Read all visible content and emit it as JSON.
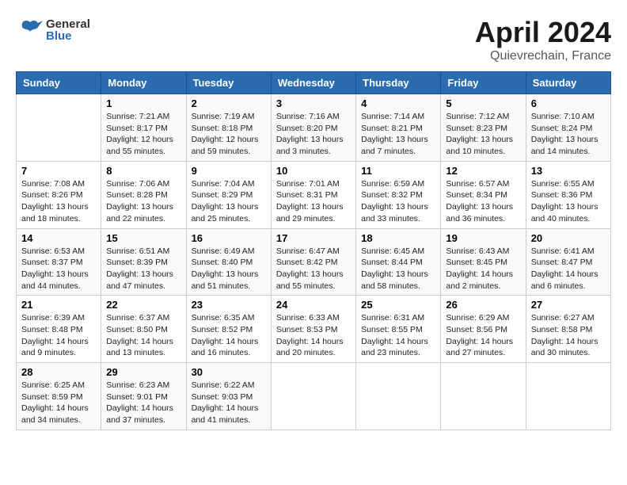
{
  "header": {
    "logo_general": "General",
    "logo_blue": "Blue",
    "title": "April 2024",
    "location": "Quievrechain, France"
  },
  "days_of_week": [
    "Sunday",
    "Monday",
    "Tuesday",
    "Wednesday",
    "Thursday",
    "Friday",
    "Saturday"
  ],
  "weeks": [
    [
      {
        "day": "",
        "sunrise": "",
        "sunset": "",
        "daylight": ""
      },
      {
        "day": "1",
        "sunrise": "Sunrise: 7:21 AM",
        "sunset": "Sunset: 8:17 PM",
        "daylight": "Daylight: 12 hours and 55 minutes."
      },
      {
        "day": "2",
        "sunrise": "Sunrise: 7:19 AM",
        "sunset": "Sunset: 8:18 PM",
        "daylight": "Daylight: 12 hours and 59 minutes."
      },
      {
        "day": "3",
        "sunrise": "Sunrise: 7:16 AM",
        "sunset": "Sunset: 8:20 PM",
        "daylight": "Daylight: 13 hours and 3 minutes."
      },
      {
        "day": "4",
        "sunrise": "Sunrise: 7:14 AM",
        "sunset": "Sunset: 8:21 PM",
        "daylight": "Daylight: 13 hours and 7 minutes."
      },
      {
        "day": "5",
        "sunrise": "Sunrise: 7:12 AM",
        "sunset": "Sunset: 8:23 PM",
        "daylight": "Daylight: 13 hours and 10 minutes."
      },
      {
        "day": "6",
        "sunrise": "Sunrise: 7:10 AM",
        "sunset": "Sunset: 8:24 PM",
        "daylight": "Daylight: 13 hours and 14 minutes."
      }
    ],
    [
      {
        "day": "7",
        "sunrise": "Sunrise: 7:08 AM",
        "sunset": "Sunset: 8:26 PM",
        "daylight": "Daylight: 13 hours and 18 minutes."
      },
      {
        "day": "8",
        "sunrise": "Sunrise: 7:06 AM",
        "sunset": "Sunset: 8:28 PM",
        "daylight": "Daylight: 13 hours and 22 minutes."
      },
      {
        "day": "9",
        "sunrise": "Sunrise: 7:04 AM",
        "sunset": "Sunset: 8:29 PM",
        "daylight": "Daylight: 13 hours and 25 minutes."
      },
      {
        "day": "10",
        "sunrise": "Sunrise: 7:01 AM",
        "sunset": "Sunset: 8:31 PM",
        "daylight": "Daylight: 13 hours and 29 minutes."
      },
      {
        "day": "11",
        "sunrise": "Sunrise: 6:59 AM",
        "sunset": "Sunset: 8:32 PM",
        "daylight": "Daylight: 13 hours and 33 minutes."
      },
      {
        "day": "12",
        "sunrise": "Sunrise: 6:57 AM",
        "sunset": "Sunset: 8:34 PM",
        "daylight": "Daylight: 13 hours and 36 minutes."
      },
      {
        "day": "13",
        "sunrise": "Sunrise: 6:55 AM",
        "sunset": "Sunset: 8:36 PM",
        "daylight": "Daylight: 13 hours and 40 minutes."
      }
    ],
    [
      {
        "day": "14",
        "sunrise": "Sunrise: 6:53 AM",
        "sunset": "Sunset: 8:37 PM",
        "daylight": "Daylight: 13 hours and 44 minutes."
      },
      {
        "day": "15",
        "sunrise": "Sunrise: 6:51 AM",
        "sunset": "Sunset: 8:39 PM",
        "daylight": "Daylight: 13 hours and 47 minutes."
      },
      {
        "day": "16",
        "sunrise": "Sunrise: 6:49 AM",
        "sunset": "Sunset: 8:40 PM",
        "daylight": "Daylight: 13 hours and 51 minutes."
      },
      {
        "day": "17",
        "sunrise": "Sunrise: 6:47 AM",
        "sunset": "Sunset: 8:42 PM",
        "daylight": "Daylight: 13 hours and 55 minutes."
      },
      {
        "day": "18",
        "sunrise": "Sunrise: 6:45 AM",
        "sunset": "Sunset: 8:44 PM",
        "daylight": "Daylight: 13 hours and 58 minutes."
      },
      {
        "day": "19",
        "sunrise": "Sunrise: 6:43 AM",
        "sunset": "Sunset: 8:45 PM",
        "daylight": "Daylight: 14 hours and 2 minutes."
      },
      {
        "day": "20",
        "sunrise": "Sunrise: 6:41 AM",
        "sunset": "Sunset: 8:47 PM",
        "daylight": "Daylight: 14 hours and 6 minutes."
      }
    ],
    [
      {
        "day": "21",
        "sunrise": "Sunrise: 6:39 AM",
        "sunset": "Sunset: 8:48 PM",
        "daylight": "Daylight: 14 hours and 9 minutes."
      },
      {
        "day": "22",
        "sunrise": "Sunrise: 6:37 AM",
        "sunset": "Sunset: 8:50 PM",
        "daylight": "Daylight: 14 hours and 13 minutes."
      },
      {
        "day": "23",
        "sunrise": "Sunrise: 6:35 AM",
        "sunset": "Sunset: 8:52 PM",
        "daylight": "Daylight: 14 hours and 16 minutes."
      },
      {
        "day": "24",
        "sunrise": "Sunrise: 6:33 AM",
        "sunset": "Sunset: 8:53 PM",
        "daylight": "Daylight: 14 hours and 20 minutes."
      },
      {
        "day": "25",
        "sunrise": "Sunrise: 6:31 AM",
        "sunset": "Sunset: 8:55 PM",
        "daylight": "Daylight: 14 hours and 23 minutes."
      },
      {
        "day": "26",
        "sunrise": "Sunrise: 6:29 AM",
        "sunset": "Sunset: 8:56 PM",
        "daylight": "Daylight: 14 hours and 27 minutes."
      },
      {
        "day": "27",
        "sunrise": "Sunrise: 6:27 AM",
        "sunset": "Sunset: 8:58 PM",
        "daylight": "Daylight: 14 hours and 30 minutes."
      }
    ],
    [
      {
        "day": "28",
        "sunrise": "Sunrise: 6:25 AM",
        "sunset": "Sunset: 8:59 PM",
        "daylight": "Daylight: 14 hours and 34 minutes."
      },
      {
        "day": "29",
        "sunrise": "Sunrise: 6:23 AM",
        "sunset": "Sunset: 9:01 PM",
        "daylight": "Daylight: 14 hours and 37 minutes."
      },
      {
        "day": "30",
        "sunrise": "Sunrise: 6:22 AM",
        "sunset": "Sunset: 9:03 PM",
        "daylight": "Daylight: 14 hours and 41 minutes."
      },
      {
        "day": "",
        "sunrise": "",
        "sunset": "",
        "daylight": ""
      },
      {
        "day": "",
        "sunrise": "",
        "sunset": "",
        "daylight": ""
      },
      {
        "day": "",
        "sunrise": "",
        "sunset": "",
        "daylight": ""
      },
      {
        "day": "",
        "sunrise": "",
        "sunset": "",
        "daylight": ""
      }
    ]
  ]
}
